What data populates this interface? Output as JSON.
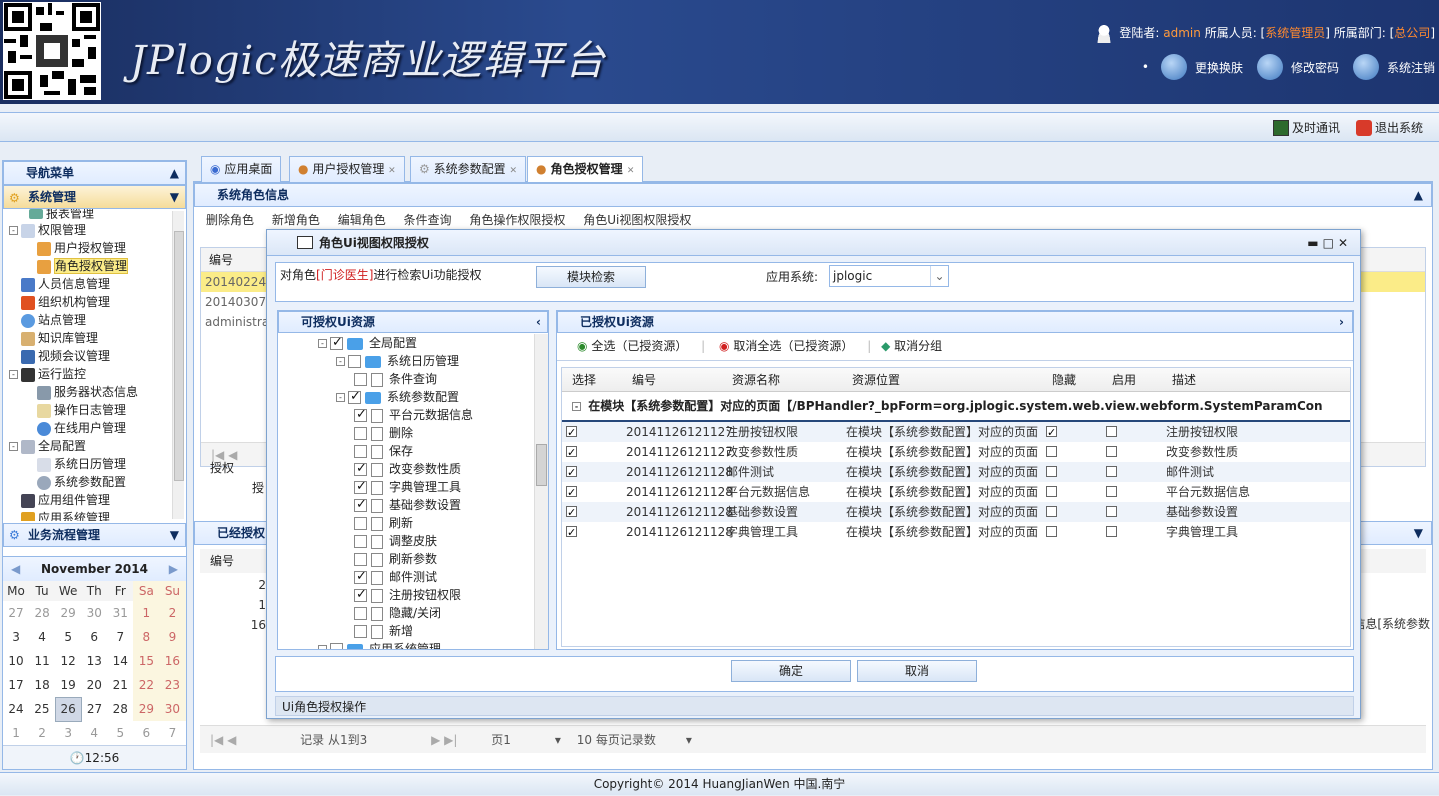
{
  "header": {
    "logo_text": "JPlogic极速商业逻辑平台",
    "login_label": "登陆者:",
    "user": "admin",
    "role_label": "所属人员: [",
    "role": "系统管理员",
    "dept_label": "] 所属部门: [",
    "dept": "总公司",
    "dept_end": "]",
    "change_skin": "更换换肤",
    "change_pwd": "修改密码",
    "logout": "系统注销"
  },
  "toolbar2": {
    "im": "及时通讯",
    "exit": "退出系统"
  },
  "nav": {
    "title": "导航菜单",
    "system_mgmt": "系统管理",
    "items": [
      "报表管理",
      "权限管理",
      "用户授权管理",
      "角色授权管理",
      "人员信息管理",
      "组织机构管理",
      "站点管理",
      "知识库管理",
      "视频会议管理",
      "运行监控",
      "服务器状态信息",
      "操作日志管理",
      "在线用户管理",
      "全局配置",
      "系统日历管理",
      "系统参数配置",
      "应用组件管理",
      "应用系统管理"
    ],
    "workflow": "业务流程管理"
  },
  "calendar": {
    "month": "November 2014",
    "days": [
      "Mo",
      "Tu",
      "We",
      "Th",
      "Fr",
      "Sa",
      "Su"
    ],
    "weeks": [
      [
        "27",
        "28",
        "29",
        "30",
        "31",
        "1",
        "2"
      ],
      [
        "3",
        "4",
        "5",
        "6",
        "7",
        "8",
        "9"
      ],
      [
        "10",
        "11",
        "12",
        "13",
        "14",
        "15",
        "16"
      ],
      [
        "17",
        "18",
        "19",
        "20",
        "21",
        "22",
        "23"
      ],
      [
        "24",
        "25",
        "26",
        "27",
        "28",
        "29",
        "30"
      ],
      [
        "1",
        "2",
        "3",
        "4",
        "5",
        "6",
        "7"
      ]
    ],
    "time": "12:56"
  },
  "tabs": [
    "应用桌面",
    "用户授权管理",
    "系统参数配置",
    "角色授权管理"
  ],
  "main": {
    "panel_title": "系统角色信息",
    "toolbar": [
      "删除角色",
      "新增角色",
      "编辑角色",
      "条件查询",
      "角色操作权限授权",
      "角色Ui视图权限授权"
    ],
    "col_id": "编号",
    "ids": [
      "20140224",
      "20140307",
      "administrato"
    ],
    "auth_label": "授权",
    "auth_btn": "授",
    "granted_title": "已经授权",
    "granted_col": "编号",
    "granted_ids": [
      "2",
      "1",
      "16"
    ],
    "right_trunc": "信息[系统参数",
    "pager": {
      "records": "记录 从1到3",
      "page": "页1",
      "per": "10 每页记录数"
    }
  },
  "dialog": {
    "title": "角色Ui视图权限授权",
    "prefix": "对角色",
    "role": "[门诊医生]",
    "suffix": "进行检索Ui功能授权",
    "search_btn": "模块检索",
    "app_label": "应用系统:",
    "app_value": "jplogic",
    "left_title": "可授权Ui资源",
    "right_title": "已授权Ui资源",
    "select_all": "全选（已授资源）",
    "cancel_all": "取消全选（已授资源）",
    "ungroup": "取消分组",
    "cols": [
      "选择",
      "编号",
      "资源名称",
      "资源位置",
      "隐藏",
      "启用",
      "描述"
    ],
    "group_row": "在模块【系统参数配置】对应的页面【/BPHandler?_bpForm=org.jplogic.system.web.view.webform.SystemParamCon",
    "rows": [
      {
        "id": "20141126121127",
        "name": "注册按钮权限",
        "loc": "在模块【系统参数配置】对应的页面",
        "desc": "注册按钮权限"
      },
      {
        "id": "20141126121127",
        "name": "改变参数性质",
        "loc": "在模块【系统参数配置】对应的页面",
        "desc": "改变参数性质"
      },
      {
        "id": "20141126121128",
        "name": "邮件测试",
        "loc": "在模块【系统参数配置】对应的页面",
        "desc": "邮件测试"
      },
      {
        "id": "20141126121128",
        "name": "平台元数据信息",
        "loc": "在模块【系统参数配置】对应的页面",
        "desc": "平台元数据信息"
      },
      {
        "id": "20141126121128",
        "name": "基础参数设置",
        "loc": "在模块【系统参数配置】对应的页面",
        "desc": "基础参数设置"
      },
      {
        "id": "20141126121128",
        "name": "字典管理工具",
        "loc": "在模块【系统参数配置】对应的页面",
        "desc": "字典管理工具"
      }
    ],
    "tree": [
      {
        "label": "全局配置",
        "kind": "folder",
        "check": "on"
      },
      {
        "label": "系统日历管理",
        "kind": "folder",
        "check": "off"
      },
      {
        "label": "条件查询",
        "kind": "doc",
        "check": "off"
      },
      {
        "label": "系统参数配置",
        "kind": "folder",
        "check": "part"
      },
      {
        "label": "平台元数据信息",
        "kind": "doc",
        "check": "on"
      },
      {
        "label": "删除",
        "kind": "doc",
        "check": "off"
      },
      {
        "label": "保存",
        "kind": "doc",
        "check": "off"
      },
      {
        "label": "改变参数性质",
        "kind": "doc",
        "check": "on"
      },
      {
        "label": "字典管理工具",
        "kind": "doc",
        "check": "on"
      },
      {
        "label": "基础参数设置",
        "kind": "doc",
        "check": "on"
      },
      {
        "label": "刷新",
        "kind": "doc",
        "check": "off"
      },
      {
        "label": "调整皮肤",
        "kind": "doc",
        "check": "off"
      },
      {
        "label": "刷新参数",
        "kind": "doc",
        "check": "off"
      },
      {
        "label": "邮件测试",
        "kind": "doc",
        "check": "on"
      },
      {
        "label": "注册按钮权限",
        "kind": "doc",
        "check": "on"
      },
      {
        "label": "隐藏/关闭",
        "kind": "doc",
        "check": "off"
      },
      {
        "label": "新增",
        "kind": "doc",
        "check": "off"
      },
      {
        "label": "应用系统管理",
        "kind": "folder",
        "check": "off"
      }
    ],
    "ok": "确定",
    "cancel": "取消",
    "status": "Ui角色授权操作"
  },
  "footer": "Copyright© 2014 HuangJianWen 中国.南宁"
}
